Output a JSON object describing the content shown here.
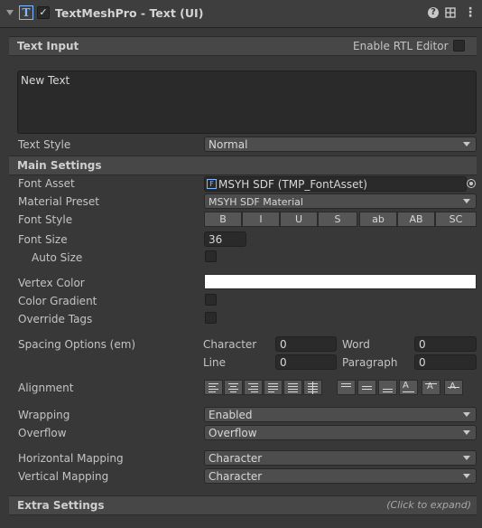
{
  "header": {
    "title": "TextMeshPro - Text (UI)",
    "icon": "text-component-icon",
    "help": "?",
    "more": "⋮"
  },
  "text_input": {
    "section": "Text Input",
    "rtl_label": "Enable RTL Editor",
    "text_value": "New Text",
    "text_style_label": "Text Style",
    "text_style_value": "Normal"
  },
  "main": {
    "section": "Main Settings",
    "font_asset_label": "Font Asset",
    "font_asset_value": "MSYH SDF (TMP_FontAsset)",
    "material_label": "Material Preset",
    "material_value": "MSYH SDF Material",
    "font_style_label": "Font Style",
    "font_style_buttons": [
      "B",
      "I",
      "U",
      "S",
      "ab",
      "AB",
      "SC"
    ],
    "font_size_label": "Font Size",
    "font_size_value": "36",
    "auto_size_label": "Auto Size",
    "vertex_color_label": "Vertex Color",
    "vertex_color_value": "#ffffff",
    "gradient_label": "Color Gradient",
    "override_label": "Override Tags",
    "spacing_label": "Spacing Options (em)",
    "character_label": "Character",
    "character_value": "0",
    "word_label": "Word",
    "word_value": "0",
    "line_label": "Line",
    "line_value": "0",
    "paragraph_label": "Paragraph",
    "paragraph_value": "0",
    "alignment_label": "Alignment",
    "wrapping_label": "Wrapping",
    "wrapping_value": "Enabled",
    "overflow_label": "Overflow",
    "overflow_value": "Overflow",
    "hmap_label": "Horizontal Mapping",
    "hmap_value": "Character",
    "vmap_label": "Vertical Mapping",
    "vmap_value": "Character"
  },
  "extra": {
    "section": "Extra Settings",
    "hint": "(Click to expand)"
  }
}
